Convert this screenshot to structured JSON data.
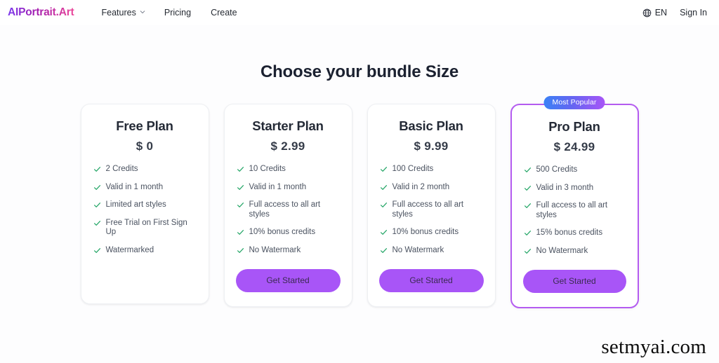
{
  "header": {
    "logo": "AIPortrait.Art",
    "nav": [
      {
        "label": "Features",
        "has_dropdown": true,
        "icon": "chevron-down-icon"
      },
      {
        "label": "Pricing",
        "has_dropdown": false
      },
      {
        "label": "Create",
        "has_dropdown": false
      }
    ],
    "language": {
      "icon": "globe-icon",
      "label": "EN"
    },
    "sign_in": "Sign In"
  },
  "main": {
    "title": "Choose your bundle Size",
    "plans": [
      {
        "name": "Free Plan",
        "price": "$ 0",
        "featured": false,
        "badge": null,
        "cta": null,
        "features": [
          "2 Credits",
          "Valid in 1 month",
          "Limited art styles",
          "Free Trial on First Sign Up",
          "Watermarked"
        ]
      },
      {
        "name": "Starter Plan",
        "price": "$ 2.99",
        "featured": false,
        "badge": null,
        "cta": "Get Started",
        "features": [
          "10 Credits",
          "Valid in 1 month",
          "Full access to all art styles",
          "10% bonus credits",
          "No Watermark"
        ]
      },
      {
        "name": "Basic Plan",
        "price": "$ 9.99",
        "featured": false,
        "badge": null,
        "cta": "Get Started",
        "features": [
          "100 Credits",
          "Valid in 2 month",
          "Full access to all art styles",
          "10% bonus credits",
          "No Watermark"
        ]
      },
      {
        "name": "Pro Plan",
        "price": "$ 24.99",
        "featured": true,
        "badge": "Most Popular",
        "cta": "Get Started",
        "features": [
          "500 Credits",
          "Valid in 3 month",
          "Full access to all art styles",
          "15% bonus credits",
          "No Watermark"
        ]
      }
    ]
  },
  "watermark": "setmyai.com",
  "colors": {
    "accent_purple": "#a855f7",
    "featured_border": "#b45cf0",
    "badge_gradient_from": "#3b82f6",
    "badge_gradient_to": "#a855f7",
    "check_green": "#22a565",
    "page_bg": "#fdfdfe",
    "text_primary": "#1f2430",
    "text_muted": "#4a5260"
  }
}
